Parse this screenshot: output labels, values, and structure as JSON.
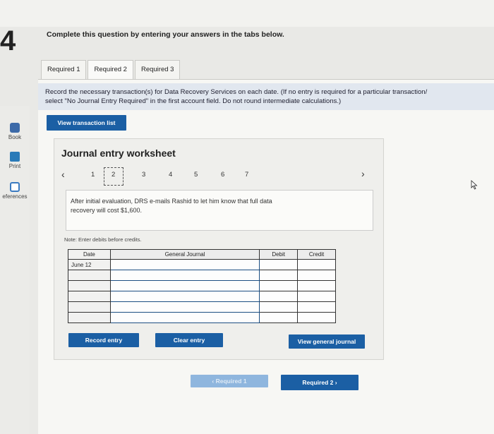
{
  "page": {
    "number_fragment": "4"
  },
  "instruction": "Complete this question by entering your answers in the tabs below.",
  "tabs": [
    {
      "label": "Required 1"
    },
    {
      "label": "Required 2"
    },
    {
      "label": "Required 3"
    }
  ],
  "record_note": {
    "line1": "Record the necessary transaction(s) for Data Recovery Services on each date. (If no entry is required for a particular transaction/",
    "line2": "select \"No Journal Entry Required\" in the first account field. Do not round intermediate calculations.)"
  },
  "sidebar": {
    "items": [
      {
        "label": "Book",
        "icon": "book-icon"
      },
      {
        "label": "Print",
        "icon": "print-icon"
      },
      {
        "label": "eferences",
        "icon": "references-icon"
      }
    ]
  },
  "buttons": {
    "view_transaction_list": "View transaction list",
    "record_entry": "Record entry",
    "clear_entry": "Clear entry",
    "view_general_journal": "View general journal",
    "prev_required": "Required 1",
    "next_required": "Required 2"
  },
  "worksheet": {
    "title": "Journal entry worksheet",
    "pages": [
      "1",
      "2",
      "3",
      "4",
      "5",
      "6",
      "7"
    ],
    "current_page": "2",
    "description": {
      "line1": "After initial evaluation, DRS e-mails Rashid to let him know that full data",
      "line2": "recovery will cost $1,600."
    },
    "note": "Note: Enter debits before credits.",
    "table": {
      "headers": {
        "date": "Date",
        "account": "General Journal",
        "debit": "Debit",
        "credit": "Credit"
      },
      "rows": [
        {
          "date": "June 12",
          "account": "",
          "debit": "",
          "credit": ""
        },
        {
          "date": "",
          "account": "",
          "debit": "",
          "credit": ""
        },
        {
          "date": "",
          "account": "",
          "debit": "",
          "credit": ""
        },
        {
          "date": "",
          "account": "",
          "debit": "",
          "credit": ""
        },
        {
          "date": "",
          "account": "",
          "debit": "",
          "credit": ""
        },
        {
          "date": "",
          "account": "",
          "debit": "",
          "credit": ""
        }
      ]
    }
  },
  "colors": {
    "accent": "#1b5fa4",
    "disabled": "#8fb6de",
    "note_bg": "#e1e7ef"
  }
}
